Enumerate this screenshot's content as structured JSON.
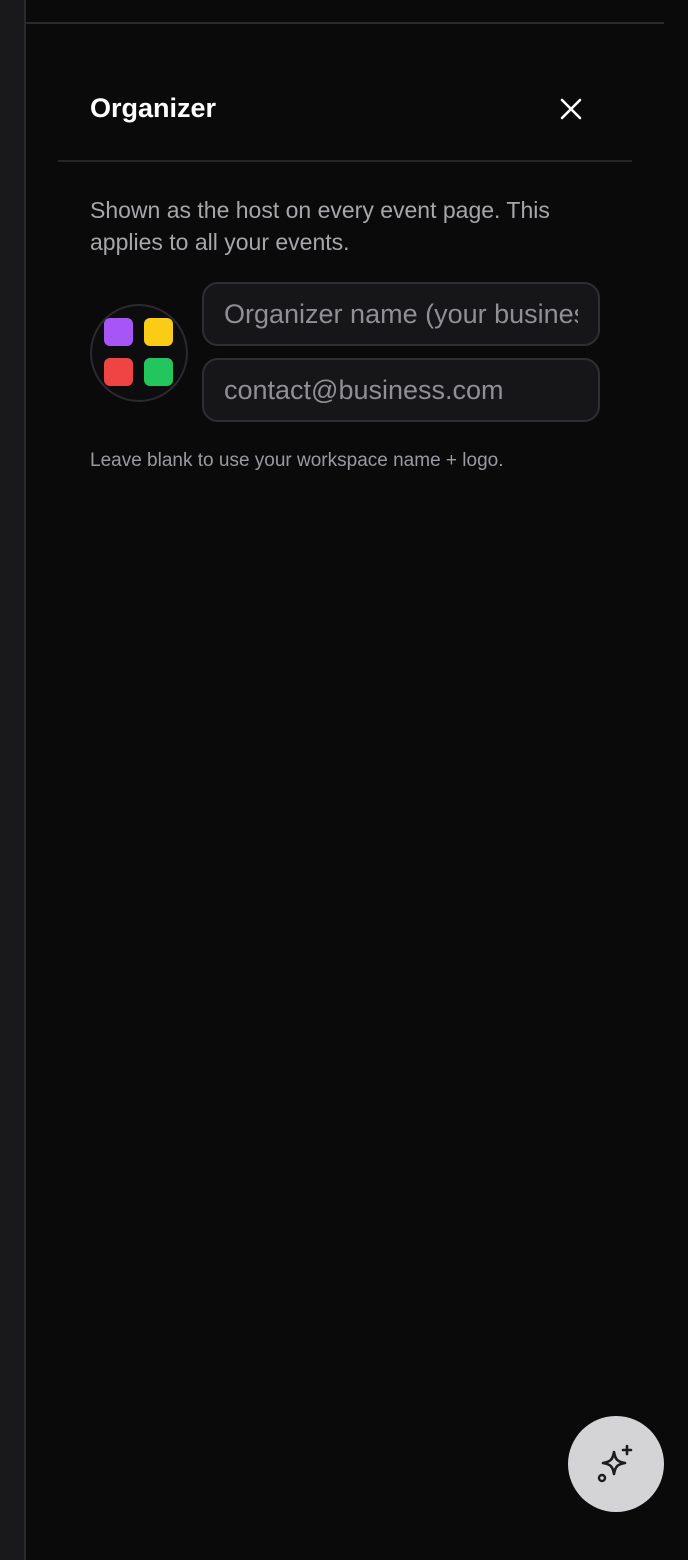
{
  "panel": {
    "title": "Organizer",
    "description": "Shown as the host on every event page. This applies to all your events.",
    "hint": "Leave blank to use your workspace name + logo."
  },
  "form": {
    "name_placeholder": "Organizer name (your business)",
    "name_value": "",
    "email_placeholder": "contact@business.com",
    "email_value": ""
  },
  "icons": {
    "close": "close-icon",
    "avatar": "app-grid-logo-icon",
    "fab": "sparkles-icon"
  },
  "colors": {
    "logo_purple": "#a855f7",
    "logo_yellow": "#facc15",
    "logo_red": "#ef4444",
    "logo_green": "#22c55e",
    "fab_background": "#d4d4d6"
  }
}
